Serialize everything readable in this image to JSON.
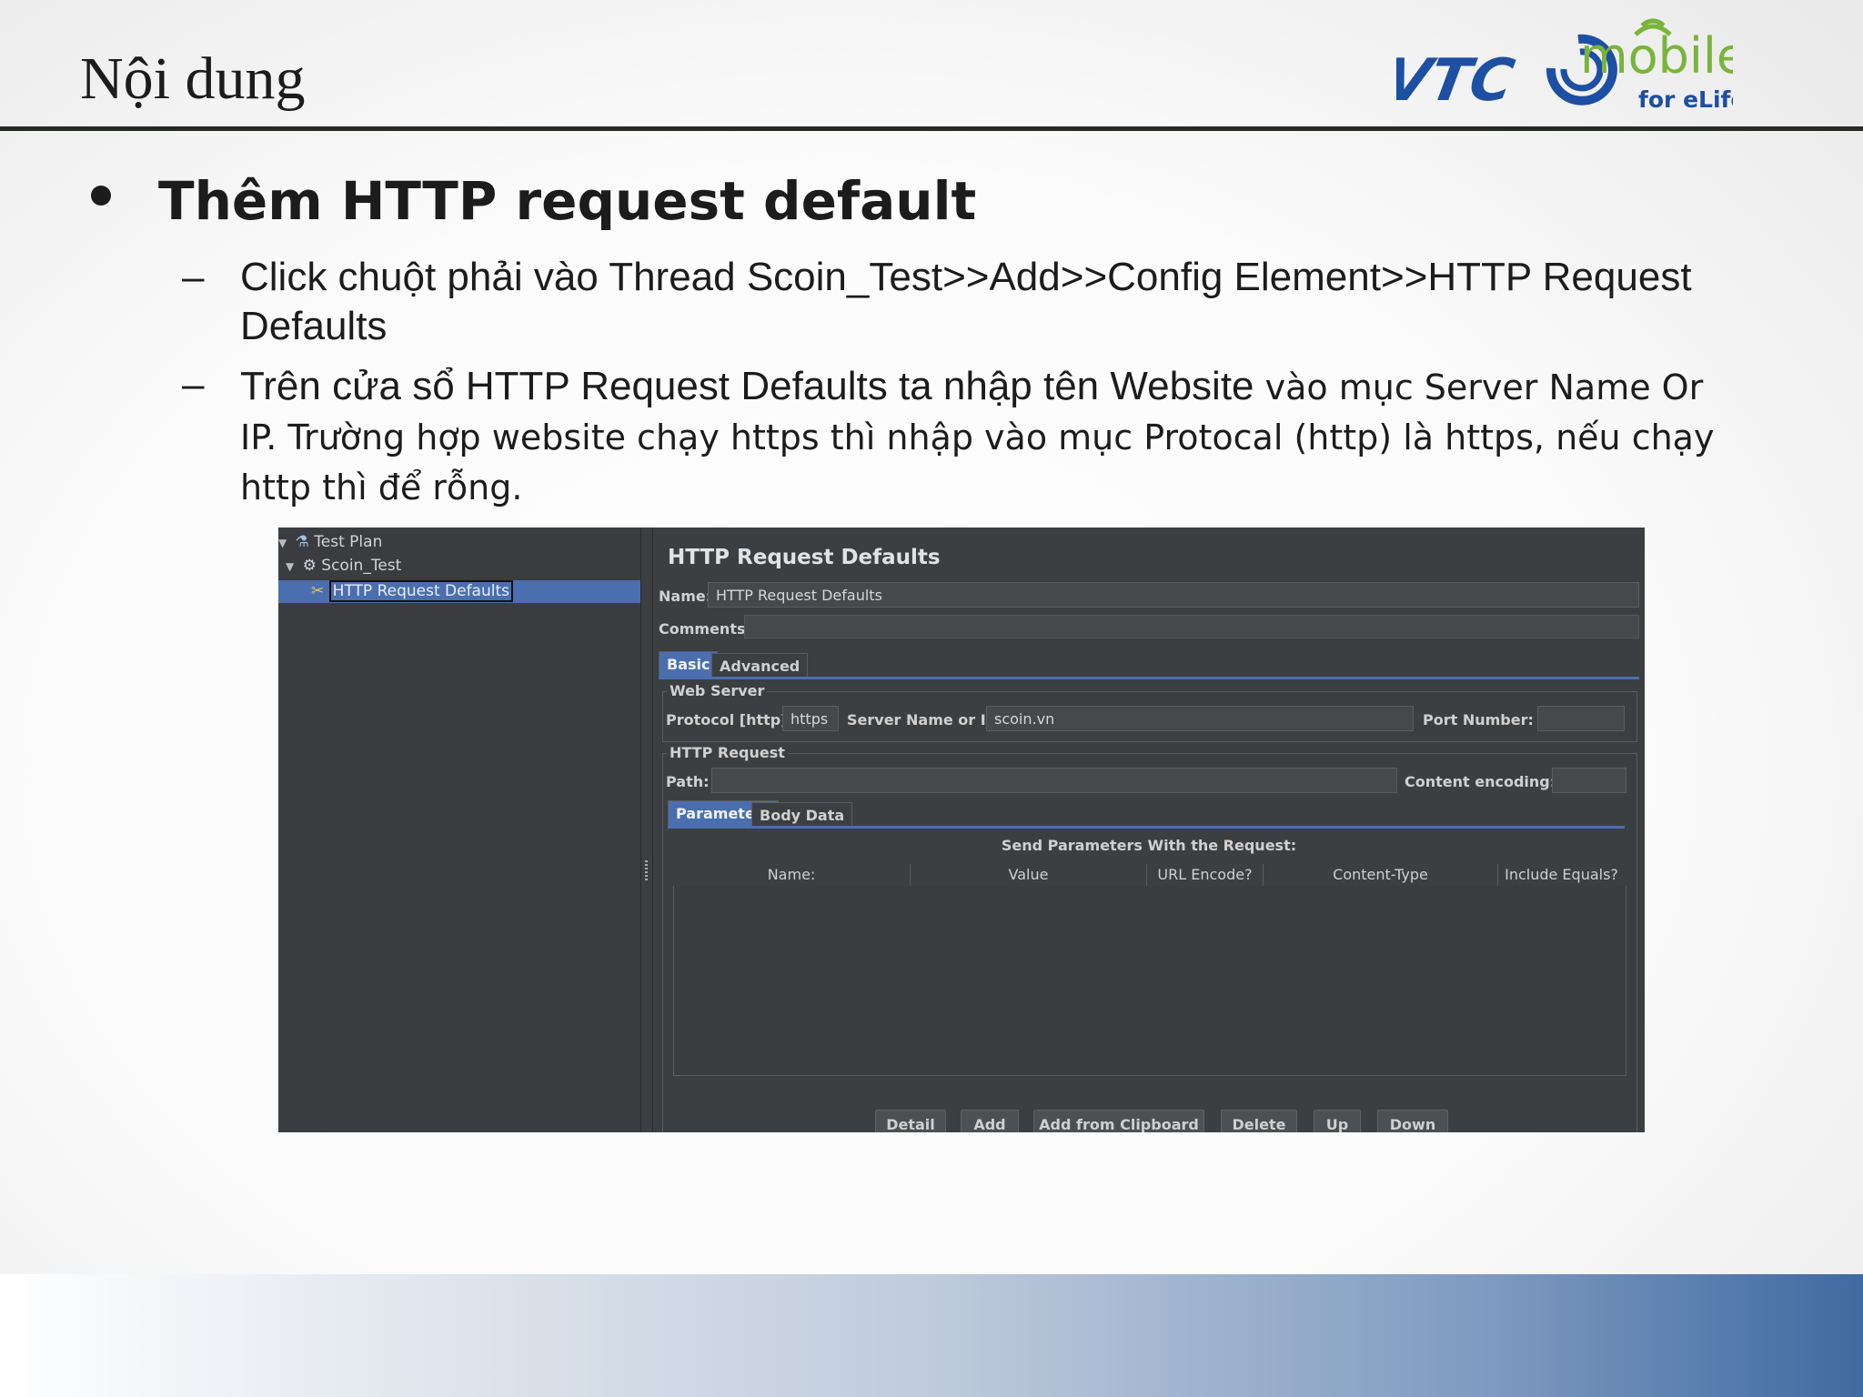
{
  "slide": {
    "title": "Nội dung",
    "logo": {
      "vtc": "VTC",
      "mobile": "mobile",
      "tagline": "for eLife"
    },
    "bullet": "Thêm HTTP request default",
    "sub1": "Click chuột phải vào Thread Scoin_Test>>Add>>Config Element>>HTTP Request Defaults",
    "sub2_big": "Trên cửa sổ HTTP Request Defaults ta nhập tên Website",
    "sub2_rest": " vào mục Server Name Or IP. Trường hợp website chạy https thì nhập vào mục Protocal (http) là https, nếu chạy http thì để rỗng.",
    "dash": "–"
  },
  "jmeter": {
    "tree": {
      "items": [
        {
          "label": "Test Plan",
          "icon": "flask-icon"
        },
        {
          "label": "Scoin_Test",
          "icon": "gear-icon"
        },
        {
          "label": "HTTP Request Defaults",
          "icon": "scissors-icon",
          "selected": true
        }
      ]
    },
    "panel_title": "HTTP Request Defaults",
    "name_label": "Name:",
    "name_value": "HTTP Request Defaults",
    "comments_label": "Comments:",
    "tabs": [
      "Basic",
      "Advanced"
    ],
    "web_server": {
      "title": "Web Server",
      "protocol_label": "Protocol [http]:",
      "protocol_value": "https",
      "server_label": "Server Name or IP:",
      "server_value": "scoin.vn",
      "port_label": "Port Number:",
      "port_value": ""
    },
    "http_request": {
      "title": "HTTP Request",
      "path_label": "Path:",
      "path_value": "",
      "encoding_label": "Content encoding:",
      "encoding_value": ""
    },
    "sub_tabs": [
      "Parameters",
      "Body Data"
    ],
    "table": {
      "caption": "Send Parameters With the Request:",
      "columns": [
        "Name:",
        "Value",
        "URL Encode?",
        "Content-Type",
        "Include Equals?"
      ]
    },
    "buttons": [
      "Detail",
      "Add",
      "Add from Clipboard",
      "Delete",
      "Up",
      "Down"
    ],
    "colors": {
      "accent": "#4b6eaf",
      "background": "#3c3f41"
    }
  }
}
